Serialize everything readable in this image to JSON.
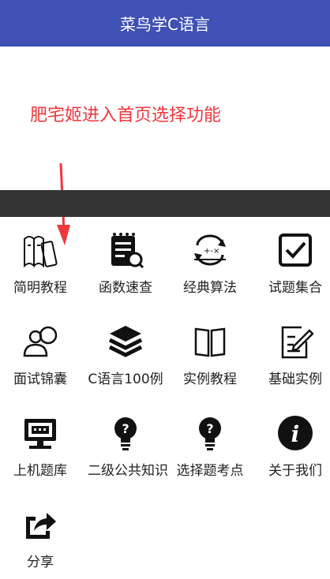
{
  "app": {
    "title": "菜鸟学C语言"
  },
  "annotation": {
    "text": "肥宅姬进入首页选择功能",
    "color": "#f0373c"
  },
  "colors": {
    "titlebar": "#3f51b5",
    "darkbar": "#333333",
    "icon": "#111111"
  },
  "menu": {
    "items": [
      {
        "label": "简明教程",
        "icon": "books-icon"
      },
      {
        "label": "函数速查",
        "icon": "function-search-icon"
      },
      {
        "label": "经典算法",
        "icon": "algorithm-icon"
      },
      {
        "label": "试题集合",
        "icon": "checkbox-icon"
      },
      {
        "label": "面试锦囊",
        "icon": "interview-icon"
      },
      {
        "label": "C语言100例",
        "icon": "layers-icon"
      },
      {
        "label": "实例教程",
        "icon": "open-book-icon"
      },
      {
        "label": "基础实例",
        "icon": "edit-note-icon"
      },
      {
        "label": "上机题库",
        "icon": "computer-icon"
      },
      {
        "label": "二级公共知识",
        "icon": "lightbulb-icon"
      },
      {
        "label": "选择题考点",
        "icon": "lightbulb-icon"
      },
      {
        "label": "关于我们",
        "icon": "info-icon"
      },
      {
        "label": "分享",
        "icon": "share-icon"
      }
    ]
  }
}
